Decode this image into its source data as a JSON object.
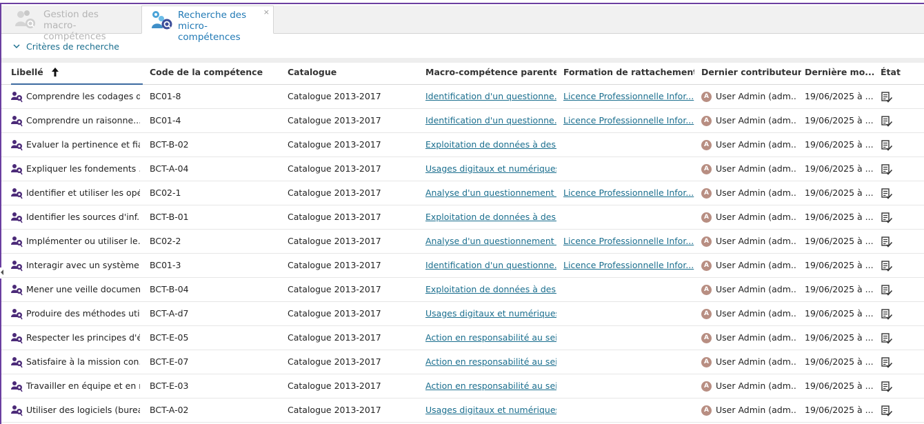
{
  "tabs": [
    {
      "label_line1": "Gestion des",
      "label_line2": "macro-compétences",
      "active": false
    },
    {
      "label_line1": "Recherche des",
      "label_line2": "micro-compétences",
      "active": true,
      "close": "×"
    }
  ],
  "criteria": {
    "label": "Critères de recherche"
  },
  "colors": {
    "accent": "#6b3fa0",
    "link": "#1a6e8e",
    "tab_active_text": "#1f78b4",
    "avatar": "#b88e82"
  },
  "table": {
    "headers": [
      "Libellé",
      "Code de la compétence",
      "Catalogue",
      "Macro-compétence parente",
      "Formation de rattachement",
      "Dernier contributeur",
      "Dernière mo...",
      "État"
    ],
    "sorted_column": "Libellé",
    "rows": [
      {
        "libelle": "Comprendre les codages d...",
        "code": "BC01-8",
        "catalogue": "Catalogue 2013-2017",
        "macro": "Identification d'un questionne...",
        "formation": "Licence Professionnelle Infor...",
        "avatar": "A",
        "contributeur": "User Admin (adm...",
        "date": "19/06/2025 à ..."
      },
      {
        "libelle": "Comprendre un raisonne...",
        "code": "BC01-4",
        "catalogue": "Catalogue 2013-2017",
        "macro": "Identification d'un questionne...",
        "formation": "Licence Professionnelle Infor...",
        "avatar": "A",
        "contributeur": "User Admin (adm...",
        "date": "19/06/2025 à ..."
      },
      {
        "libelle": "Evaluer la pertinence et fia...",
        "code": "BCT-B-02",
        "catalogue": "Catalogue 2013-2017",
        "macro": "Exploitation de données à des...",
        "formation": "",
        "avatar": "A",
        "contributeur": "User Admin (adm...",
        "date": "19/06/2025 à ..."
      },
      {
        "libelle": "Expliquer les fondements ...",
        "code": "BCT-A-04",
        "catalogue": "Catalogue 2013-2017",
        "macro": "Usages digitaux et numériques",
        "formation": "",
        "avatar": "A",
        "contributeur": "User Admin (adm...",
        "date": "19/06/2025 à ..."
      },
      {
        "libelle": "Identifier et utiliser les opé...",
        "code": "BC02-1",
        "catalogue": "Catalogue 2013-2017",
        "macro": "Analyse d'un questionnement ...",
        "formation": "Licence Professionnelle Infor...",
        "avatar": "A",
        "contributeur": "User Admin (adm...",
        "date": "19/06/2025 à ..."
      },
      {
        "libelle": "Identifier les sources d'inf...",
        "code": "BCT-B-01",
        "catalogue": "Catalogue 2013-2017",
        "macro": "Exploitation de données à des...",
        "formation": "",
        "avatar": "A",
        "contributeur": "User Admin (adm...",
        "date": "19/06/2025 à ..."
      },
      {
        "libelle": "Implémenter ou utiliser le...",
        "code": "BC02-2",
        "catalogue": "Catalogue 2013-2017",
        "macro": "Analyse d'un questionnement ...",
        "formation": "Licence Professionnelle Infor...",
        "avatar": "A",
        "contributeur": "User Admin (adm...",
        "date": "19/06/2025 à ..."
      },
      {
        "libelle": "Interagir avec un système ...",
        "code": "BC01-3",
        "catalogue": "Catalogue 2013-2017",
        "macro": "Identification d'un questionne...",
        "formation": "Licence Professionnelle Infor...",
        "avatar": "A",
        "contributeur": "User Admin (adm...",
        "date": "19/06/2025 à ..."
      },
      {
        "libelle": "Mener une veille documen...",
        "code": "BCT-B-04",
        "catalogue": "Catalogue 2013-2017",
        "macro": "Exploitation de données à des...",
        "formation": "",
        "avatar": "A",
        "contributeur": "User Admin (adm...",
        "date": "19/06/2025 à ..."
      },
      {
        "libelle": "Produire des méthodes uti...",
        "code": "BCT-A-d7",
        "catalogue": "Catalogue 2013-2017",
        "macro": "Usages digitaux et numériques",
        "formation": "",
        "avatar": "A",
        "contributeur": "User Admin (adm...",
        "date": "19/06/2025 à ..."
      },
      {
        "libelle": "Respecter les principes d'é...",
        "code": "BCT-E-05",
        "catalogue": "Catalogue 2013-2017",
        "macro": "Action en responsabilité au sei...",
        "formation": "",
        "avatar": "A",
        "contributeur": "User Admin (adm...",
        "date": "19/06/2025 à ..."
      },
      {
        "libelle": "Satisfaire à la mission con...",
        "code": "BCT-E-07",
        "catalogue": "Catalogue 2013-2017",
        "macro": "Action en responsabilité au sei...",
        "formation": "",
        "avatar": "A",
        "contributeur": "User Admin (adm...",
        "date": "19/06/2025 à ..."
      },
      {
        "libelle": "Travailler en équipe et en r...",
        "code": "BCT-E-03",
        "catalogue": "Catalogue 2013-2017",
        "macro": "Action en responsabilité au sei...",
        "formation": "",
        "avatar": "A",
        "contributeur": "User Admin (adm...",
        "date": "19/06/2025 à ..."
      },
      {
        "libelle": "Utiliser des logiciels (burea...",
        "code": "BCT-A-02",
        "catalogue": "Catalogue 2013-2017",
        "macro": "Usages digitaux et numériques",
        "formation": "",
        "avatar": "A",
        "contributeur": "User Admin (adm...",
        "date": "19/06/2025 à ..."
      }
    ]
  }
}
